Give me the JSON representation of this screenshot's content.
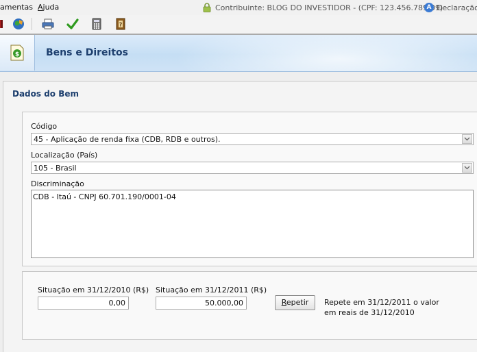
{
  "menu": {
    "items": [
      {
        "pre": "",
        "ul": "",
        "post": "amentas"
      },
      {
        "pre": "",
        "ul": "A",
        "post": "juda"
      }
    ]
  },
  "status": {
    "contribuinte": "Contribuinte: BLOG DO INVESTIDOR - (CPF: 123.456.789-09)",
    "declaracao": "Declaração d",
    "declaracao_badge": "A"
  },
  "toolbar": {
    "icons": [
      "book-icon",
      "globe-icon",
      "print-icon",
      "check-icon",
      "calculator-icon",
      "help-book-icon"
    ]
  },
  "header": {
    "title": "Bens e Direitos",
    "icon": "money-document-icon"
  },
  "form": {
    "section_title": "Dados do Bem",
    "codigo_label": "Código",
    "codigo_value": "45 - Aplicação de renda fixa (CDB, RDB e outros).",
    "localizacao_label": "Localização (País)",
    "localizacao_value": "105 - Brasil",
    "discriminacao_label": "Discriminação",
    "discriminacao_value": "CDB - Itaú - CNPJ 60.701.190/0001-04",
    "situacao_2010_label": "Situação em 31/12/2010 (R$)",
    "situacao_2010_value": "0,00",
    "situacao_2011_label": "Situação em 31/12/2011 (R$)",
    "situacao_2011_value": "50.000,00",
    "repetir_ul": "R",
    "repetir_rest": "epetir",
    "repetir_hint_1": "Repete em 31/12/2011 o valor",
    "repetir_hint_2": "em reais de 31/12/2010"
  },
  "colors": {
    "title_blue": "#1d3f6e",
    "header_bg": "#c5def4",
    "check_green": "#2e9a1e"
  }
}
